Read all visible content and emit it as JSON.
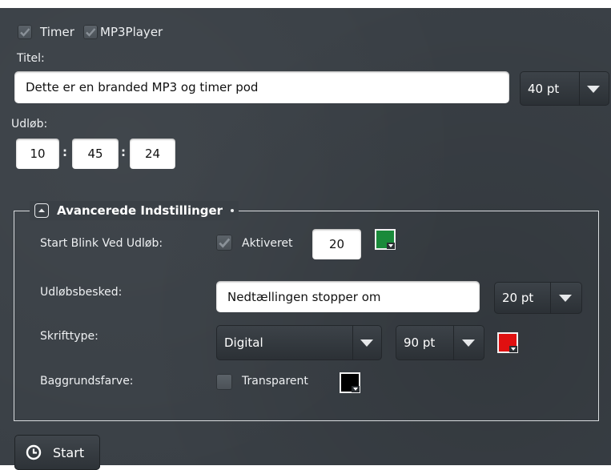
{
  "top": {
    "timer": {
      "label": "Timer",
      "checked": true
    },
    "mp3": {
      "label": "MP3Player",
      "checked": true
    }
  },
  "title": {
    "label": "Titel:",
    "value": "Dette er en branded MP3 og timer pod",
    "size": "40 pt"
  },
  "expiry": {
    "label": "Udløb:",
    "hours": "10",
    "minutes": "45",
    "seconds": "24",
    "separator": ":"
  },
  "advanced": {
    "legend": "Avancerede Indstillinger",
    "blink": {
      "label": "Start Blink Ved Udløb:",
      "checkbox_label": "Aktiveret",
      "checked": true,
      "value": "20",
      "color": "#1a8a3a"
    },
    "message": {
      "label": "Udløbsbesked:",
      "value": "Nedtællingen stopper om",
      "size": "20 pt"
    },
    "font": {
      "label": "Skrifttype:",
      "value": "Digital",
      "size": "90 pt",
      "color": "#e01010"
    },
    "background": {
      "label": "Baggrundsfarve:",
      "checkbox_label": "Transparent",
      "checked": false,
      "color": "#000000"
    }
  },
  "start_button": {
    "label": "Start",
    "icon": "clock-icon"
  }
}
